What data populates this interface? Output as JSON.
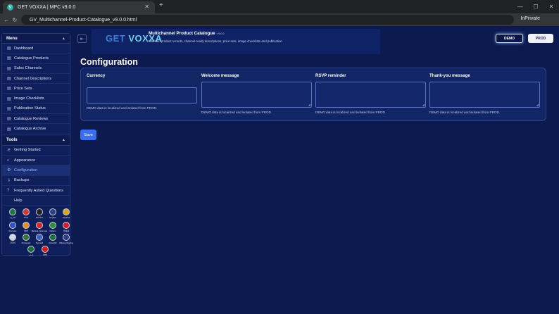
{
  "browser": {
    "tab_title": "GET VOXXA | MPC v9.0.0",
    "tab_icon": "V",
    "url": "GV_Multichannel-Product-Catalogue_v9.0.0.html",
    "mode_label": "InPrivate"
  },
  "header": {
    "logo_a": "GET ",
    "logo_b": "VOXXA",
    "title": "Multichannel Product Catalogue",
    "version": "v9.0.0",
    "subtitle": "Maintain product records, channel-ready descriptions, price sets, image checklists and publication",
    "demo_label": "DEMO",
    "prod_label": "PROD"
  },
  "sidebar": {
    "menu_title": "Menu",
    "menu_items": [
      {
        "label": "Dashboard",
        "icon": "grid-icon"
      },
      {
        "label": "Catalogue Products",
        "icon": "grid-icon"
      },
      {
        "label": "Sales Channels",
        "icon": "grid-icon"
      },
      {
        "label": "Channel Descriptions",
        "icon": "grid-icon"
      },
      {
        "label": "Price Sets",
        "icon": "grid-icon"
      },
      {
        "label": "Image Checklists",
        "icon": "grid-icon"
      },
      {
        "label": "Publication Status",
        "icon": "grid-icon"
      },
      {
        "label": "Catalogue Reviews",
        "icon": "grid-icon"
      },
      {
        "label": "Catalogue Archive",
        "icon": "grid-icon"
      }
    ],
    "tools_title": "Tools",
    "tools_items": [
      {
        "label": "Getting Started",
        "icon": "sliders-icon"
      },
      {
        "label": "Appearance",
        "icon": "palette-icon"
      },
      {
        "label": "Configuration",
        "icon": "gear-icon"
      },
      {
        "label": "Backups",
        "icon": "download-icon"
      },
      {
        "label": "Frequently Asked Questions",
        "icon": "question-icon"
      },
      {
        "label": "Help",
        "icon": "help-icon"
      }
    ],
    "languages": [
      {
        "label": "العربية",
        "color": "#1e7a3a"
      },
      {
        "label": "বাংলা",
        "color": "#d23a2f"
      },
      {
        "label": "Deutsch",
        "color": "#222222"
      },
      {
        "label": "English",
        "color": "#2d3f8a"
      },
      {
        "label": "Español",
        "color": "#d9a21f"
      },
      {
        "label": "Français",
        "color": "#2d53c2"
      },
      {
        "label": "हिन्दी",
        "color": "#e38b2c"
      },
      {
        "label": "Bahasa Indonesia",
        "color": "#d12a2a"
      },
      {
        "label": "Italiano",
        "color": "#2f8c3b"
      },
      {
        "label": "日本語",
        "color": "#d21d2d"
      },
      {
        "label": "한국어",
        "color": "#d1d6e6"
      },
      {
        "label": "Português",
        "color": "#2f7a3a"
      },
      {
        "label": "Русский",
        "color": "#3c5fc2"
      },
      {
        "label": "Kiswahili",
        "color": "#1f6e3a"
      },
      {
        "label": "Wikang Tagalog",
        "color": "#2f3c8a"
      },
      {
        "label": "اردو",
        "color": "#1b6e34"
      },
      {
        "label": "中文",
        "color": "#d81f1f"
      }
    ]
  },
  "main": {
    "title": "Configuration",
    "fields": [
      {
        "label": "Currency",
        "note": "DEMO data is localized and isolated from PROD."
      },
      {
        "label": "Welcome message",
        "note": "DEMO data is localized and isolated from PROD."
      },
      {
        "label": "RSVP reminder",
        "note": "DEMO data is localized and isolated from PROD."
      },
      {
        "label": "Thank-you message",
        "note": "DEMO data is localized and isolated from PROD."
      }
    ],
    "save_label": "Save"
  }
}
